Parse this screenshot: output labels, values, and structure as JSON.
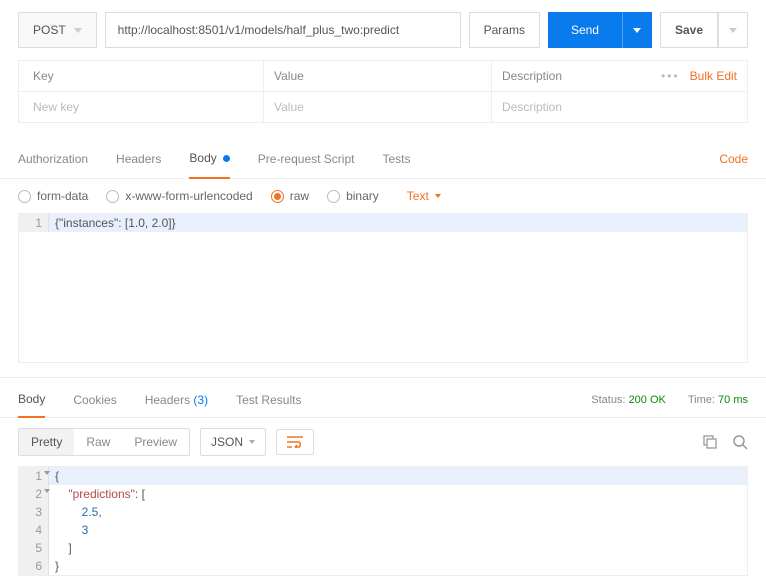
{
  "request": {
    "method": "POST",
    "url": "http://localhost:8501/v1/models/half_plus_two:predict",
    "params_label": "Params",
    "send_label": "Send",
    "save_label": "Save",
    "kv": {
      "headers": {
        "key": "Key",
        "value": "Value",
        "description": "Description"
      },
      "placeholder": {
        "key": "New key",
        "value": "Value",
        "description": "Description"
      },
      "bulk_edit": "Bulk Edit"
    },
    "tabs": {
      "authorization": "Authorization",
      "headers": "Headers",
      "body": "Body",
      "prerequest": "Pre-request Script",
      "tests": "Tests",
      "code": "Code"
    },
    "body_types": {
      "form_data": "form-data",
      "urlencoded": "x-www-form-urlencoded",
      "raw": "raw",
      "binary": "binary",
      "text_dd": "Text"
    },
    "raw_body": "{\"instances\": [1.0, 2.0]}"
  },
  "response": {
    "tabs": {
      "body": "Body",
      "cookies": "Cookies",
      "headers": "Headers",
      "headers_count": "(3)",
      "test_results": "Test Results"
    },
    "status": {
      "label": "Status:",
      "value": "200 OK"
    },
    "time": {
      "label": "Time:",
      "value": "70 ms"
    },
    "views": {
      "pretty": "Pretty",
      "raw": "Raw",
      "preview": "Preview"
    },
    "format": "JSON",
    "body_lines": {
      "l1": "{",
      "l2": "    \"predictions\": [",
      "l3": "        2.5,",
      "l4": "        3",
      "l5": "    ]",
      "l6": "}"
    }
  },
  "chart_data": {
    "type": "table",
    "title": "REST request/response body",
    "request_body": {
      "instances": [
        1.0,
        2.0
      ]
    },
    "response_body": {
      "predictions": [
        2.5,
        3
      ]
    }
  }
}
